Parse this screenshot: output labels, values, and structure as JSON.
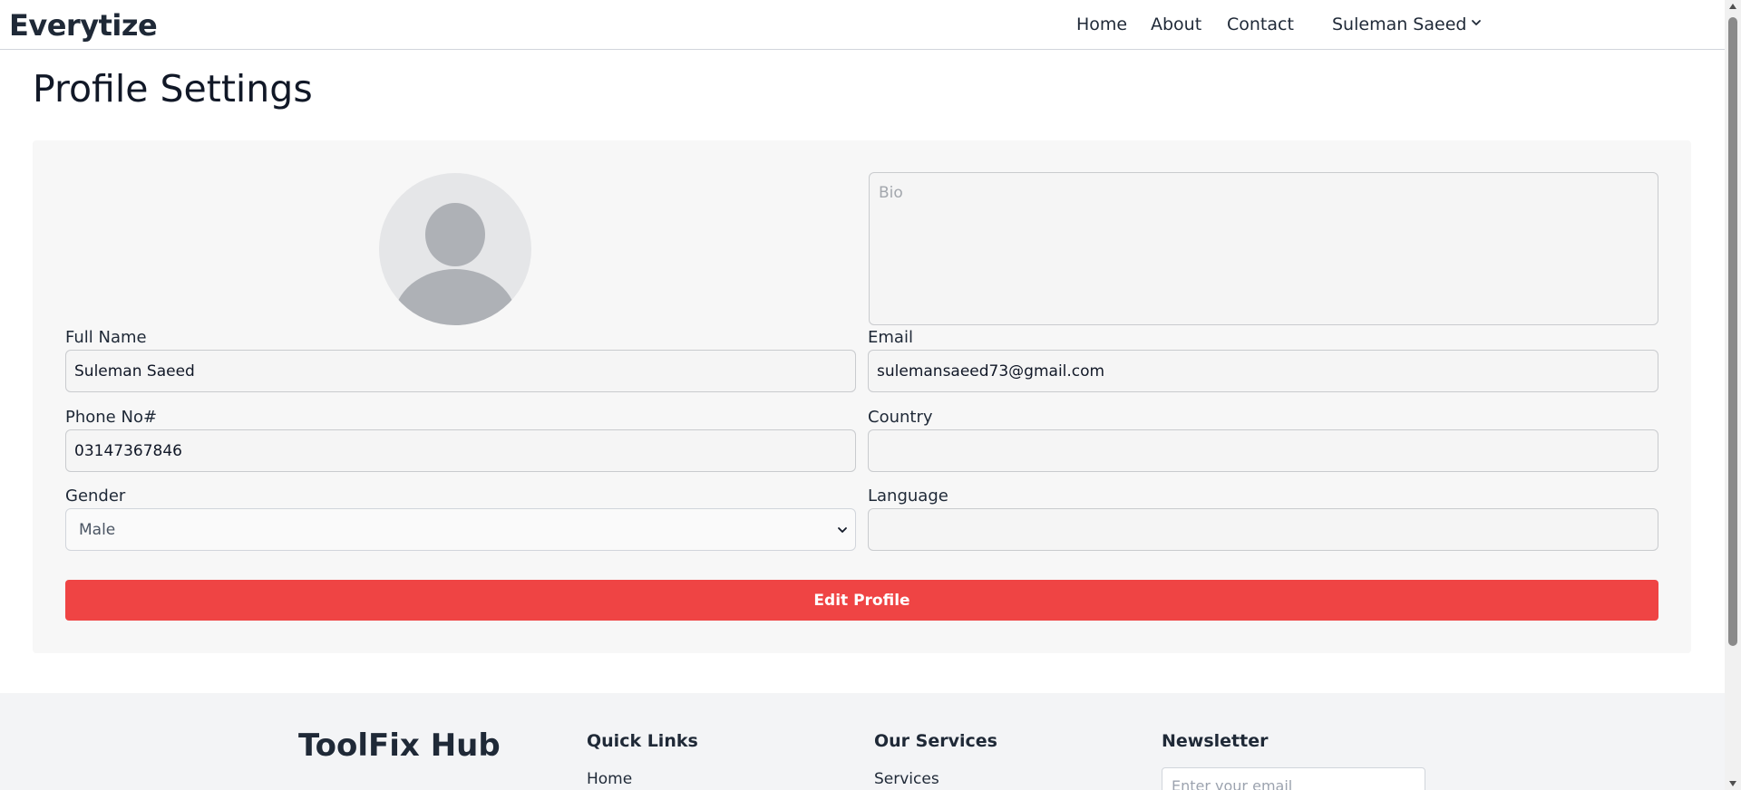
{
  "navbar": {
    "brand": "Everytize",
    "links": [
      "Home",
      "About",
      "Contact"
    ],
    "user_name": "Suleman Saeed"
  },
  "page": {
    "title": "Profile Settings"
  },
  "form": {
    "bio_placeholder": "Bio",
    "full_name_label": "Full Name",
    "full_name_value": "Suleman Saeed",
    "email_label": "Email",
    "email_value": "sulemansaeed73@gmail.com",
    "phone_label": "Phone No#",
    "phone_value": "03147367846",
    "country_label": "Country",
    "country_value": "",
    "gender_label": "Gender",
    "gender_value": "Male",
    "language_label": "Language",
    "language_value": "",
    "submit_label": "Edit Profile"
  },
  "footer": {
    "brand": "ToolFix Hub",
    "quick_links_heading": "Quick Links",
    "quick_links": [
      "Home"
    ],
    "services_heading": "Our Services",
    "services": [
      "Services"
    ],
    "newsletter_heading": "Newsletter",
    "newsletter_placeholder": "Enter your email"
  },
  "colors": {
    "primary_button": "#ef4444",
    "card_background": "#f7f7f7",
    "footer_background": "#f3f4f6"
  },
  "icons": {
    "avatar": "user-placeholder-icon",
    "nav_dropdown": "chevron-down-icon",
    "select_dropdown": "chevron-down-icon"
  }
}
